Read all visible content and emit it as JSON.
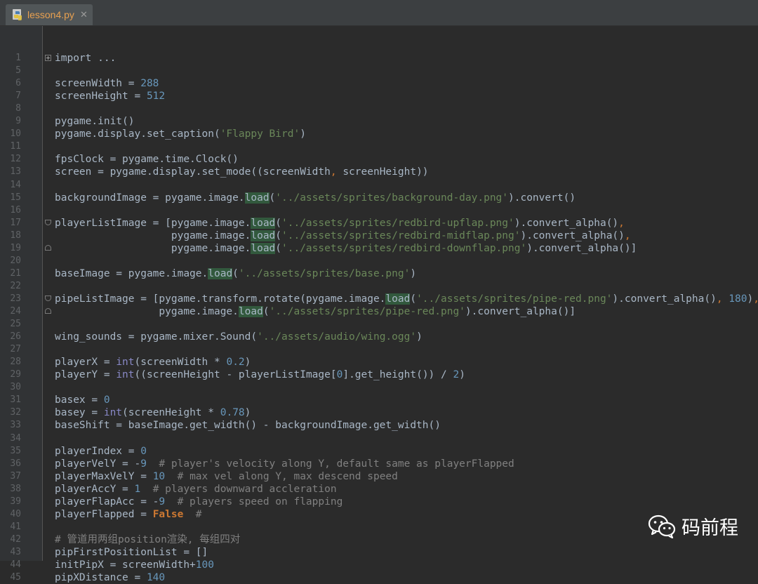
{
  "tab": {
    "label": "lesson4.py",
    "close": "✕",
    "icon": "python-file-icon"
  },
  "colors": {
    "background": "#2b2b2b",
    "gutter": "#313335",
    "line_number": "#606366",
    "default_text": "#a9b7c6",
    "keyword": "#cc7832",
    "number": "#6897bb",
    "string": "#6a8759",
    "comment": "#808080",
    "builtin": "#8888c6",
    "highlight_bg": "#32593d",
    "tab_label": "#e8a050"
  },
  "lines": [
    {
      "n": "1",
      "fold": "plus",
      "segs": [
        [
          "import ...",
          "d"
        ]
      ]
    },
    {
      "n": "5",
      "segs": []
    },
    {
      "n": "6",
      "segs": [
        [
          "screenWidth = ",
          "d"
        ],
        [
          "288",
          "n"
        ]
      ]
    },
    {
      "n": "7",
      "segs": [
        [
          "screenHeight = ",
          "d"
        ],
        [
          "512",
          "n"
        ]
      ]
    },
    {
      "n": "8",
      "segs": []
    },
    {
      "n": "9",
      "segs": [
        [
          "pygame.init()",
          "d"
        ]
      ]
    },
    {
      "n": "10",
      "segs": [
        [
          "pygame.display.set_caption(",
          "d"
        ],
        [
          "'Flappy Bird'",
          "s"
        ],
        [
          ")",
          "d"
        ]
      ]
    },
    {
      "n": "11",
      "segs": []
    },
    {
      "n": "12",
      "segs": [
        [
          "fpsClock = pygame.time.Clock()",
          "d"
        ]
      ]
    },
    {
      "n": "13",
      "segs": [
        [
          "screen = pygame.display.set_mode((screenWidth",
          "d"
        ],
        [
          ", ",
          "k"
        ],
        [
          "screenHeight))",
          "d"
        ]
      ]
    },
    {
      "n": "14",
      "segs": []
    },
    {
      "n": "15",
      "segs": [
        [
          "backgroundImage = pygame.image.",
          "d"
        ],
        [
          "load",
          "h"
        ],
        [
          "(",
          "d"
        ],
        [
          "'../assets/sprites/background-day.png'",
          "s"
        ],
        [
          ").convert()",
          "d"
        ]
      ]
    },
    {
      "n": "16",
      "segs": []
    },
    {
      "n": "17",
      "fold": "open",
      "segs": [
        [
          "playerListImage = [pygame.image.",
          "d"
        ],
        [
          "load",
          "h"
        ],
        [
          "(",
          "d"
        ],
        [
          "'../assets/sprites/redbird-upflap.png'",
          "s"
        ],
        [
          ").convert_alpha()",
          "d"
        ],
        [
          ",",
          "k"
        ]
      ]
    },
    {
      "n": "18",
      "segs": [
        [
          "                   pygame.image.",
          "d"
        ],
        [
          "load",
          "h"
        ],
        [
          "(",
          "d"
        ],
        [
          "'../assets/sprites/redbird-midflap.png'",
          "s"
        ],
        [
          ").convert_alpha()",
          "d"
        ],
        [
          ",",
          "k"
        ]
      ]
    },
    {
      "n": "19",
      "fold": "close",
      "segs": [
        [
          "                   pygame.image.",
          "d"
        ],
        [
          "load",
          "h"
        ],
        [
          "(",
          "d"
        ],
        [
          "'../assets/sprites/redbird-downflap.png'",
          "s"
        ],
        [
          ").convert_alpha()]",
          "d"
        ]
      ]
    },
    {
      "n": "20",
      "segs": []
    },
    {
      "n": "21",
      "segs": [
        [
          "baseImage = pygame.image.",
          "d"
        ],
        [
          "load",
          "h"
        ],
        [
          "(",
          "d"
        ],
        [
          "'../assets/sprites/base.png'",
          "s"
        ],
        [
          ")",
          "d"
        ]
      ]
    },
    {
      "n": "22",
      "segs": []
    },
    {
      "n": "23",
      "fold": "open",
      "segs": [
        [
          "pipeListImage = [pygame.transform.rotate(pygame.image.",
          "d"
        ],
        [
          "load",
          "h"
        ],
        [
          "(",
          "d"
        ],
        [
          "'../assets/sprites/pipe-red.png'",
          "s"
        ],
        [
          ").convert_alpha()",
          "d"
        ],
        [
          ", ",
          "k"
        ],
        [
          "180",
          "n"
        ],
        [
          ")",
          "d"
        ],
        [
          ",",
          "k"
        ]
      ]
    },
    {
      "n": "24",
      "fold": "close",
      "segs": [
        [
          "                 pygame.image.",
          "d"
        ],
        [
          "load",
          "h"
        ],
        [
          "(",
          "d"
        ],
        [
          "'../assets/sprites/pipe-red.png'",
          "s"
        ],
        [
          ").convert_alpha()]",
          "d"
        ]
      ]
    },
    {
      "n": "25",
      "segs": []
    },
    {
      "n": "26",
      "segs": [
        [
          "wing_sounds = pygame.mixer.Sound(",
          "d"
        ],
        [
          "'../assets/audio/wing.ogg'",
          "s"
        ],
        [
          ")",
          "d"
        ]
      ]
    },
    {
      "n": "27",
      "segs": []
    },
    {
      "n": "28",
      "segs": [
        [
          "playerX = ",
          "d"
        ],
        [
          "int",
          "b"
        ],
        [
          "(screenWidth * ",
          "d"
        ],
        [
          "0.2",
          "n"
        ],
        [
          ")",
          "d"
        ]
      ]
    },
    {
      "n": "29",
      "segs": [
        [
          "playerY = ",
          "d"
        ],
        [
          "int",
          "b"
        ],
        [
          "((screenHeight - playerListImage[",
          "d"
        ],
        [
          "0",
          "n"
        ],
        [
          "].get_height()) / ",
          "d"
        ],
        [
          "2",
          "n"
        ],
        [
          ")",
          "d"
        ]
      ]
    },
    {
      "n": "30",
      "segs": []
    },
    {
      "n": "31",
      "segs": [
        [
          "basex = ",
          "d"
        ],
        [
          "0",
          "n"
        ]
      ]
    },
    {
      "n": "32",
      "segs": [
        [
          "basey = ",
          "d"
        ],
        [
          "int",
          "b"
        ],
        [
          "(screenHeight * ",
          "d"
        ],
        [
          "0.78",
          "n"
        ],
        [
          ")",
          "d"
        ]
      ]
    },
    {
      "n": "33",
      "segs": [
        [
          "baseShift = baseImage.get_width() - backgroundImage.get_width()",
          "d"
        ]
      ]
    },
    {
      "n": "34",
      "segs": []
    },
    {
      "n": "35",
      "segs": [
        [
          "playerIndex = ",
          "d"
        ],
        [
          "0",
          "n"
        ]
      ]
    },
    {
      "n": "36",
      "segs": [
        [
          "playerVelY = -",
          "d"
        ],
        [
          "9",
          "n"
        ],
        [
          "  # player's velocity along Y, default same as playerFlapped",
          "c"
        ]
      ]
    },
    {
      "n": "37",
      "segs": [
        [
          "playerMaxVelY = ",
          "d"
        ],
        [
          "10",
          "n"
        ],
        [
          "  # max vel along Y, max descend speed",
          "c"
        ]
      ]
    },
    {
      "n": "38",
      "segs": [
        [
          "playerAccY = ",
          "d"
        ],
        [
          "1",
          "n"
        ],
        [
          "  # players downward accleration",
          "c"
        ]
      ]
    },
    {
      "n": "39",
      "segs": [
        [
          "playerFlapAcc = -",
          "d"
        ],
        [
          "9",
          "n"
        ],
        [
          "  # players speed on flapping",
          "c"
        ]
      ]
    },
    {
      "n": "40",
      "segs": [
        [
          "playerFlapped = ",
          "d"
        ],
        [
          "False",
          "k"
        ],
        [
          "  #",
          "c"
        ]
      ]
    },
    {
      "n": "41",
      "segs": []
    },
    {
      "n": "42",
      "segs": [
        [
          "# 管道用两组position渲染, 每组四对",
          "c"
        ]
      ]
    },
    {
      "n": "43",
      "segs": [
        [
          "pipFirstPositionList = []",
          "d"
        ]
      ]
    },
    {
      "n": "44",
      "segs": [
        [
          "initPipX = screenWidth+",
          "d"
        ],
        [
          "100",
          "n"
        ]
      ]
    },
    {
      "n": "45",
      "segs": [
        [
          "pipXDistance = ",
          "d"
        ],
        [
          "140",
          "n"
        ]
      ]
    }
  ],
  "watermark": {
    "text": "码前程",
    "icon": "wechat-icon"
  }
}
